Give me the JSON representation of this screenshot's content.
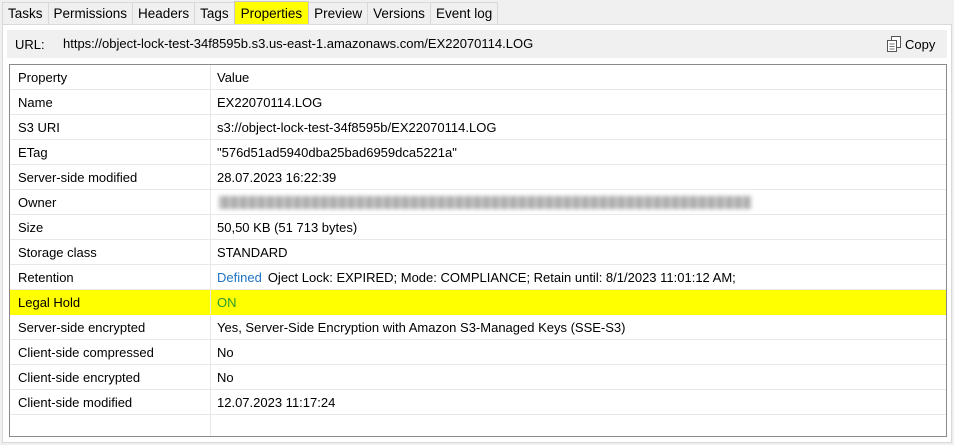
{
  "tabs": [
    {
      "label": "Tasks",
      "active": false
    },
    {
      "label": "Permissions",
      "active": false
    },
    {
      "label": "Headers",
      "active": false
    },
    {
      "label": "Tags",
      "active": false
    },
    {
      "label": "Properties",
      "active": true
    },
    {
      "label": "Preview",
      "active": false
    },
    {
      "label": "Versions",
      "active": false
    },
    {
      "label": "Event log",
      "active": false
    }
  ],
  "url": {
    "label": "URL:",
    "value": "https://object-lock-test-34f8595b.s3.us-east-1.amazonaws.com/EX22070114.LOG",
    "copy_label": "Copy"
  },
  "table": {
    "headers": {
      "property": "Property",
      "value": "Value"
    },
    "rows": [
      {
        "property": "Name",
        "value": "EX22070114.LOG"
      },
      {
        "property": "S3 URI",
        "value": "s3://object-lock-test-34f8595b/EX22070114.LOG"
      },
      {
        "property": "ETag",
        "value": "\"576d51ad5940dba25bad6959dca5221a\""
      },
      {
        "property": "Server-side modified",
        "value": "28.07.2023 16:22:39"
      },
      {
        "property": "Owner",
        "value": ""
      },
      {
        "property": "Size",
        "value": "50,50 KB (51 713 bytes)"
      },
      {
        "property": "Storage class",
        "value": "STANDARD"
      },
      {
        "property": "Retention",
        "link": "Defined",
        "value": "Oject Lock: EXPIRED; Mode: COMPLIANCE; Retain until: 8/1/2023 11:01:12 AM;"
      },
      {
        "property": "Legal Hold",
        "value": "ON"
      },
      {
        "property": "Server-side encrypted",
        "value": "Yes, Server-Side Encryption with Amazon S3-Managed Keys (SSE-S3)"
      },
      {
        "property": "Client-side compressed",
        "value": "No"
      },
      {
        "property": "Client-side encrypted",
        "value": "No"
      },
      {
        "property": "Client-side modified",
        "value": "12.07.2023 11:17:24"
      }
    ]
  },
  "colors": {
    "active_tab": "#ffff00",
    "highlight_row": "#ffff00",
    "link": "#1f74c4",
    "on_status": "#2e9b2e"
  },
  "icons": {
    "copy": "copy-icon"
  }
}
